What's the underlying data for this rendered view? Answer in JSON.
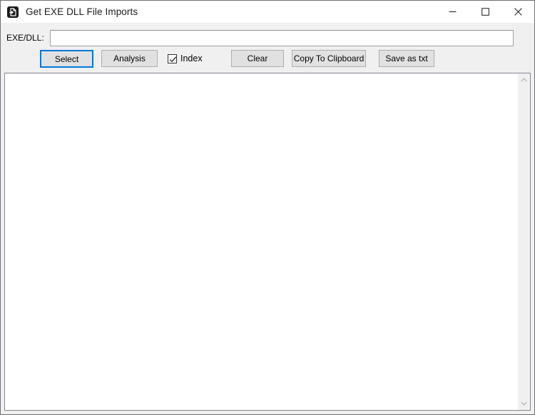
{
  "window": {
    "title": "Get EXE DLL File Imports",
    "icon": "app-import-icon",
    "border_color": "#6f6f6f",
    "titlebar_bg": "#ffffff",
    "toolbar_bg": "#f0f0f0"
  },
  "caption": {
    "minimize": "minimize-icon",
    "maximize": "maximize-icon",
    "close": "close-icon"
  },
  "toolbar": {
    "field_label": "EXE/DLL:",
    "path_value": "",
    "path_placeholder": "",
    "select_label": "Select",
    "analysis_label": "Analysis",
    "index_label": "Index",
    "index_checked": true,
    "clear_label": "Clear",
    "copy_label": "Copy To Clipboard",
    "save_label": "Save as txt",
    "accent_color": "#0078d7",
    "button_face": "#e1e1e1",
    "button_border": "#adadad"
  },
  "content": {
    "text": "",
    "background": "#ffffff",
    "border_color": "#828790"
  },
  "scrollbar": {
    "up_icon": "chevron-up-icon",
    "down_icon": "chevron-down-icon",
    "track_color": "#f0f0f0"
  }
}
